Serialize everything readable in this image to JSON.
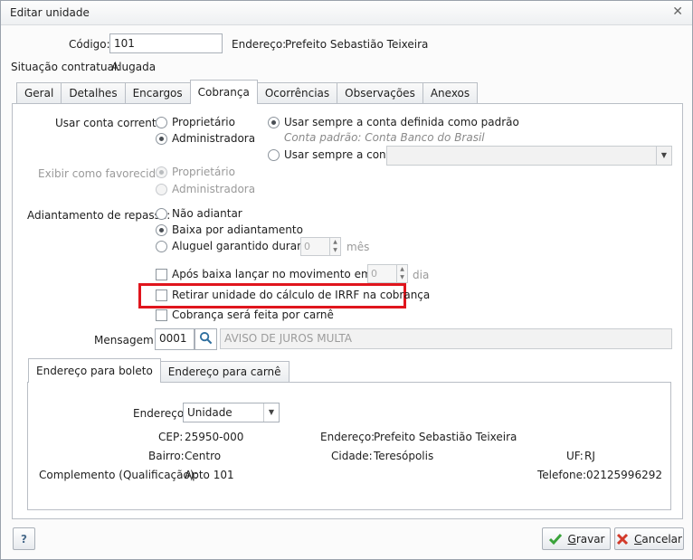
{
  "window": {
    "title": "Editar unidade"
  },
  "header": {
    "codigo_label": "Código:",
    "codigo_value": "101",
    "endereco_label": "Endereço:",
    "endereco_value": "Prefeito Sebastião Teixeira",
    "situacao_label": "Situação contratual:",
    "situacao_value": "Alugada"
  },
  "tabs": [
    "Geral",
    "Detalhes",
    "Encargos",
    "Cobrança",
    "Ocorrências",
    "Observações",
    "Anexos"
  ],
  "active_tab": "Cobrança",
  "cobranca": {
    "usar_conta_label": "Usar conta corrente:",
    "usar_conta_options": [
      "Proprietário",
      "Administradora"
    ],
    "usar_conta_selected": "Administradora",
    "conta_options": {
      "padrao_label": "Usar sempre a conta definida como padrão",
      "padrao_hint": "Conta padrão: Conta Banco do Brasil",
      "sempre_label": "Usar sempre a conta:",
      "selected": "padrao"
    },
    "favorecido_label": "Exibir como favorecido:",
    "favorecido_options": [
      "Proprietário",
      "Administradora"
    ],
    "favorecido_selected": "Proprietário",
    "adiantamento_label": "Adiantamento de repasse:",
    "adiantamento_options": [
      "Não adiantar",
      "Baixa por adiantamento",
      "Aluguel garantido durante"
    ],
    "adiantamento_selected": "Baixa por adiantamento",
    "meses_value": "0",
    "meses_unit": "mês",
    "apos_baixa_label": "Após baixa lançar no movimento em até",
    "apos_baixa_value": "0",
    "apos_baixa_unit": "dia",
    "retirar_irrf_label": "Retirar unidade do cálculo de IRRF na cobrança",
    "carne_label": "Cobrança será feita por carnê",
    "mensagem_label": "Mensagem:",
    "mensagem_code": "0001",
    "mensagem_text": "AVISO DE JUROS MULTA"
  },
  "address_tabs": [
    "Endereço para boleto",
    "Endereço para carnê"
  ],
  "address": {
    "endereco_select_label": "Endereço:",
    "endereco_select_value": "Unidade",
    "cep_label": "CEP:",
    "cep_value": "25950-000",
    "endereco_label": "Endereço:",
    "endereco_value": "Prefeito Sebastião Teixeira",
    "bairro_label": "Bairro:",
    "bairro_value": "Centro",
    "cidade_label": "Cidade:",
    "cidade_value": "Teresópolis",
    "uf_label": "UF:",
    "uf_value": "RJ",
    "complemento_label": "Complemento (Qualificação):",
    "complemento_value": "Apto 101",
    "telefone_label": "Telefone:",
    "telefone_value": "02125996292"
  },
  "footer": {
    "help_label": "?",
    "save_label": "Gravar",
    "cancel_label": "Cancelar"
  },
  "colors": {
    "highlight": "#e0151d",
    "save_check": "#3aa33a",
    "cancel_x": "#d23a2a"
  }
}
